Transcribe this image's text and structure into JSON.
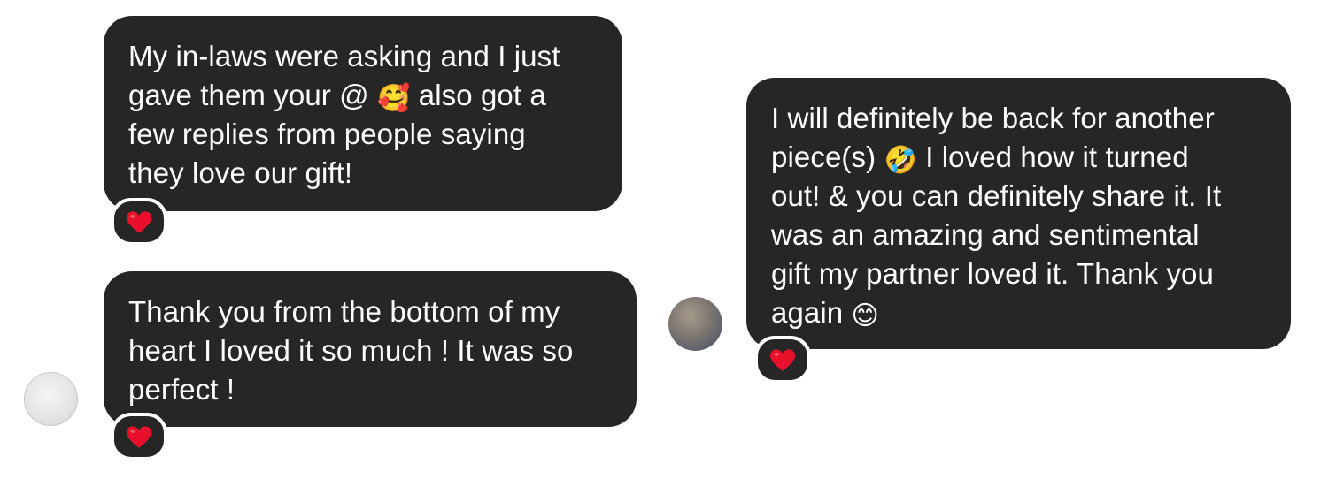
{
  "messages": [
    {
      "lines": [
        "My in-laws were asking and I just",
        "gave them your @",
        "also got a",
        "few replies from people saying",
        "they love our gift!"
      ],
      "emoji_icons": [
        "smiling-face-with-hearts-icon"
      ],
      "reaction": "heart"
    },
    {
      "lines": [
        "Thank you from the bottom of my",
        "heart I loved it so much ! It was so",
        "perfect !"
      ],
      "reaction": "heart"
    },
    {
      "lines": [
        "I will definitely be back for another",
        "piece(s)",
        "I loved how it turned",
        "out! & you can definitely share it. It",
        "was an amazing and sentimental",
        "gift my partner loved it. Thank you",
        "again"
      ],
      "emoji_icons": [
        "rolling-on-floor-laughing-icon",
        "smiling-face-icon"
      ],
      "reaction": "heart"
    }
  ],
  "colors": {
    "bubble": "#262626",
    "text": "#ffffff",
    "heart": "#e8102a",
    "background": "#ffffff"
  }
}
